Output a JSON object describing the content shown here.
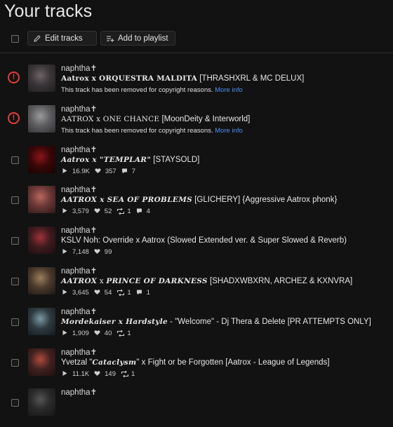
{
  "page": {
    "title": "Your tracks"
  },
  "toolbar": {
    "edit_label": "Edit tracks",
    "add_label": "Add to playlist"
  },
  "removed_notice": "This track has been removed for copyright reasons.",
  "more_info": "More info",
  "tracks": [
    {
      "artist": "naphtha✝",
      "title_parts": [
        {
          "t": "Aatrox x ORQUESTRA MALDITA",
          "s": "ser2b"
        },
        {
          "t": " [THRASHXRL & MC DELUX]",
          "s": "plain"
        }
      ],
      "removed": true,
      "art": [
        "#3a3538",
        "#6d6266",
        "#1f1c1d"
      ]
    },
    {
      "artist": "naphtha✝",
      "title_parts": [
        {
          "t": "AATROX x ONE CHANCE",
          "s": "ser2"
        },
        {
          "t": " [MoonDeity & Interworld]",
          "s": "plain"
        }
      ],
      "removed": true,
      "art": [
        "#5d5d5f",
        "#9a9a9c",
        "#303032"
      ]
    },
    {
      "artist": "naphtha✝",
      "title_parts": [
        {
          "t": "Aatrox x \"TEMPLAR\"",
          "s": "ser"
        },
        {
          "t": " [STAYSOLD]",
          "s": "plain"
        }
      ],
      "plays": "16.9K",
      "likes": "357",
      "reposts": "",
      "comments": "7",
      "art": [
        "#3a0708",
        "#8b1518",
        "#140303"
      ]
    },
    {
      "artist": "naphtha✝",
      "title_parts": [
        {
          "t": "AATROX x SEA OF PROBLEMS",
          "s": "ser"
        },
        {
          "t": " [GLICHERY] {Aggressive Aatrox phonk}",
          "s": "plain"
        }
      ],
      "plays": "3,579",
      "likes": "52",
      "reposts": "1",
      "comments": "4",
      "art": [
        "#6b3836",
        "#b8675e",
        "#2b1819"
      ]
    },
    {
      "artist": "naphtha✝",
      "title_parts": [
        {
          "t": "KSLV Noh: Override x Aatrox (Slowed Extended ver. & Super Slowed & Reverb)",
          "s": "plain"
        }
      ],
      "plays": "7,148",
      "likes": "99",
      "reposts": "",
      "comments": "",
      "art": [
        "#3e1b1e",
        "#a1323a",
        "#1a0e10"
      ]
    },
    {
      "artist": "naphtha✝",
      "title_parts": [
        {
          "t": "AATROX",
          "s": "ser"
        },
        {
          "t": " x ",
          "s": "ser2"
        },
        {
          "t": "PRINCE OF DARKNESS",
          "s": "ser"
        },
        {
          "t": " [SHADXWBXRN, ARCHEZ & KXNVRA]",
          "s": "plain"
        }
      ],
      "plays": "3,645",
      "likes": "54",
      "reposts": "1",
      "comments": "1",
      "art": [
        "#4b3a2c",
        "#9a7f5e",
        "#1c1612"
      ]
    },
    {
      "artist": "naphtha✝",
      "title_parts": [
        {
          "t": "Mordekaiser x Hardstyle",
          "s": "ser"
        },
        {
          "t": " - \"Welcome\" - Dj Thera & Delete [PR ATTEMPTS ONLY]",
          "s": "plain"
        }
      ],
      "plays": "1,909",
      "likes": "40",
      "reposts": "1",
      "comments": "",
      "art": [
        "#2e3a40",
        "#7c97a4",
        "#131a1e"
      ]
    },
    {
      "artist": "naphtha✝",
      "title_parts": [
        {
          "t": "Yvetzal \"",
          "s": "plain"
        },
        {
          "t": "Cataclysm",
          "s": "ser"
        },
        {
          "t": "\" x Fight or be Forgotten [Aatrox - League of Legends]",
          "s": "plain"
        }
      ],
      "plays": "11.1K",
      "likes": "149",
      "reposts": "1",
      "comments": "",
      "art": [
        "#41221f",
        "#b04a3e",
        "#1d0f0e"
      ]
    },
    {
      "artist": "naphtha✝",
      "title_parts": [],
      "art": [
        "#2a2a2a",
        "#555",
        "#151515"
      ]
    }
  ]
}
